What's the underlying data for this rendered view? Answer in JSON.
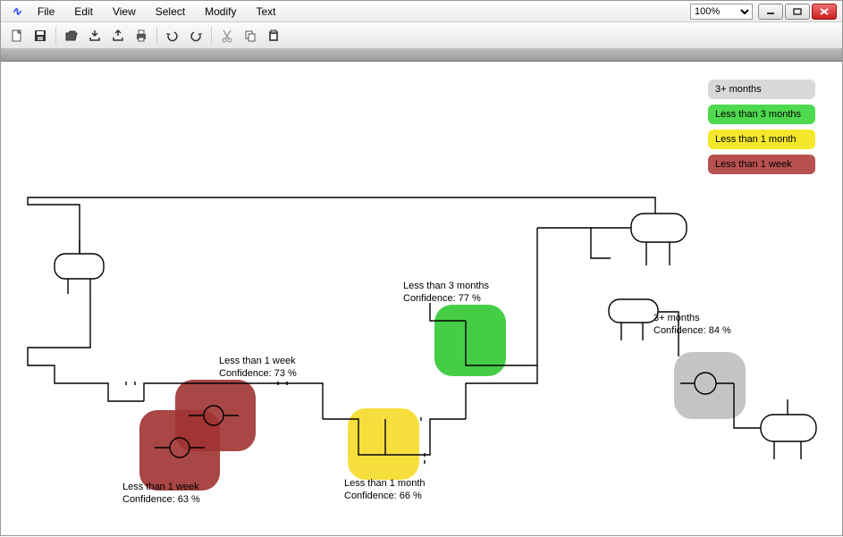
{
  "menu": {
    "items": [
      "File",
      "Edit",
      "View",
      "Select",
      "Modify",
      "Text"
    ]
  },
  "zoom": {
    "value": "100%"
  },
  "toolbar": {
    "buttons": [
      {
        "name": "new-icon"
      },
      {
        "name": "save-icon"
      },
      {
        "name": "open-icon"
      },
      {
        "name": "import-icon"
      },
      {
        "name": "export-icon"
      },
      {
        "name": "print-icon"
      },
      {
        "name": "undo-icon"
      },
      {
        "name": "redo-icon"
      },
      {
        "name": "cut-icon"
      },
      {
        "name": "copy-icon"
      },
      {
        "name": "paste-icon"
      }
    ]
  },
  "legend": {
    "items": [
      {
        "label": "3+ months",
        "cls": "leg-grey"
      },
      {
        "label": "Less than 3 months",
        "cls": "leg-green"
      },
      {
        "label": "Less than 1 month",
        "cls": "leg-yellow"
      },
      {
        "label": "Less than 1 week",
        "cls": "leg-red"
      }
    ]
  },
  "nodes": {
    "red1": {
      "status_line": "Less than 1 week",
      "conf_line": "Confidence: 63 %"
    },
    "red2": {
      "status_line": "Less than 1 week",
      "conf_line": "Confidence: 73 %"
    },
    "green": {
      "status_line": "Less than 3 months",
      "conf_line": "Confidence: 77 %"
    },
    "yellow": {
      "status_line": "Less than 1 month",
      "conf_line": "Confidence: 66 %"
    },
    "grey": {
      "status_line": "3+ months",
      "conf_line": "Confidence: 84 %"
    }
  }
}
